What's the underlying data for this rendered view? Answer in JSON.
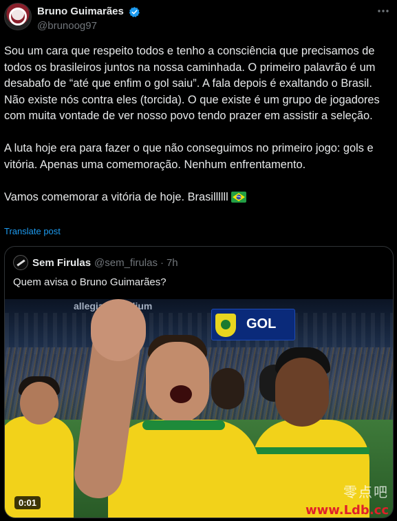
{
  "author": {
    "display_name": "Bruno Guimarães",
    "handle": "@brunoog97",
    "verified": true
  },
  "tweet": {
    "text": "Sou um cara que respeito todos e tenho a consciência que precisamos de todos os brasileiros juntos na nossa caminhada. O primeiro palavrão é um desabafo de “até que enfim o gol saiu”. A fala depois é exaltando o Brasil. Não existe nós contra eles (torcida). O que existe é um grupo de jogadores com muita vontade de ver nosso povo tendo prazer em assistir a seleção.\n\nA luta hoje era para fazer o que não conseguimos no primeiro jogo: gols e vitória. Apenas uma comemoração. Nenhum enfrentamento.\n\nVamos comemorar a vitória de hoje. Brasillllll",
    "emoji": "brazil-flag",
    "translate_label": "Translate post"
  },
  "quoted": {
    "display_name": "Sem Firulas",
    "handle": "@sem_firulas",
    "separator": "·",
    "time": "7h",
    "text": "Quem avisa o Bruno Guimarães?",
    "video": {
      "timecode": "0:01",
      "stadium_sign": "allegiant stadium",
      "scoreboard_text": "GOL"
    }
  },
  "watermark": {
    "text": "零点吧",
    "url": "www.Ldb.cc"
  },
  "colors": {
    "background": "#000000",
    "text": "#e7e9ea",
    "secondary": "#71767b",
    "link": "#1d9bf0",
    "verified": "#1d9bf0",
    "border": "#2f3336"
  }
}
